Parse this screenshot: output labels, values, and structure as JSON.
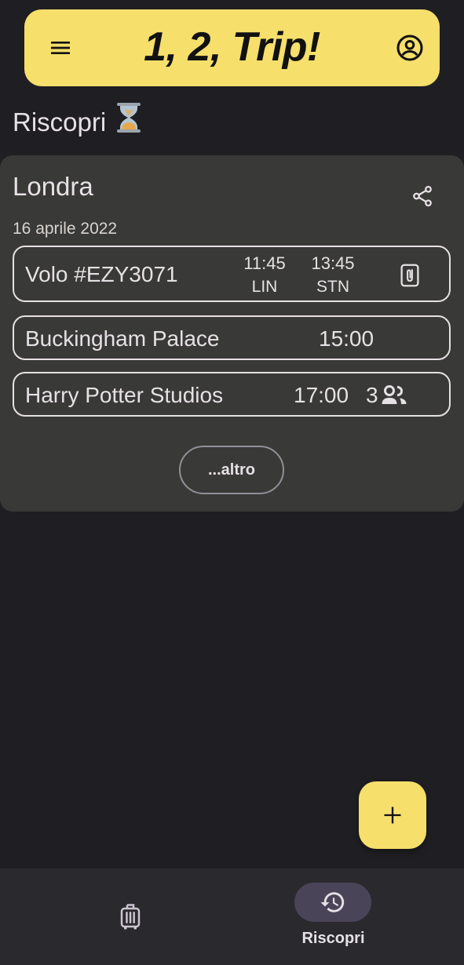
{
  "app": {
    "title": "1, 2, Trip!"
  },
  "section": {
    "title": "Riscopri",
    "emoji": "⏳"
  },
  "trip": {
    "name": "Londra",
    "date": "16 aprile 2022",
    "items": {
      "flight": {
        "label": "Volo #EZY3071",
        "dep_time": "11:45",
        "dep_code": "LIN",
        "arr_time": "13:45",
        "arr_code": "STN"
      },
      "buckingham": {
        "label": "Buckingham Palace",
        "time": "15:00"
      },
      "harry_potter": {
        "label": "Harry Potter Studios",
        "time": "17:00",
        "participants": "3"
      }
    },
    "more_label": "...altro"
  },
  "bottom_nav": {
    "rediscover_label": "Riscopri"
  },
  "colors": {
    "accent": "#f6df6b",
    "background": "#1f1e22",
    "card": "#393937",
    "nav_bg": "#2a292e",
    "nav_pill": "#4a4458"
  },
  "icons": {
    "menu": "menu-icon",
    "account": "account-circle-icon",
    "share": "share-icon",
    "attachment": "attachment-icon",
    "people": "people-icon",
    "add": "plus-icon",
    "trips": "luggage-icon",
    "rediscover": "history-icon"
  }
}
